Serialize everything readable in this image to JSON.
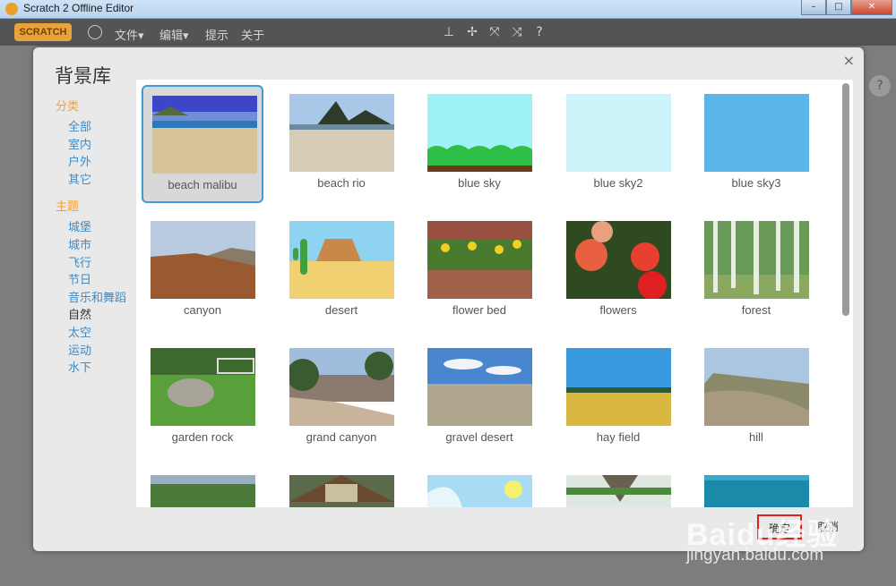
{
  "window": {
    "title": "Scratch 2 Offline Editor"
  },
  "menubar": {
    "logo": "SCRATCH",
    "items": [
      "文件▾",
      "编辑▾",
      "提示",
      "关于"
    ]
  },
  "dialog": {
    "title": "背景库",
    "close": "×",
    "categories": {
      "heading": "分类",
      "items": [
        "全部",
        "室内",
        "户外",
        "其它"
      ]
    },
    "themes": {
      "heading": "主题",
      "items": [
        "城堡",
        "城市",
        "飞行",
        "节日",
        "音乐和舞蹈",
        "自然",
        "太空",
        "运动",
        "水下"
      ],
      "active": "自然"
    },
    "backdrops": [
      {
        "name": "beach malibu",
        "selected": true
      },
      {
        "name": "beach rio"
      },
      {
        "name": "blue sky"
      },
      {
        "name": "blue sky2"
      },
      {
        "name": "blue sky3"
      },
      {
        "name": "canyon"
      },
      {
        "name": "desert"
      },
      {
        "name": "flower bed"
      },
      {
        "name": "flowers"
      },
      {
        "name": "forest"
      },
      {
        "name": "garden rock"
      },
      {
        "name": "grand canyon"
      },
      {
        "name": "gravel desert"
      },
      {
        "name": "hay field"
      },
      {
        "name": "hill"
      },
      {
        "name": ""
      },
      {
        "name": ""
      },
      {
        "name": ""
      },
      {
        "name": ""
      },
      {
        "name": ""
      }
    ],
    "ok_label": "确定",
    "cancel_label": "取消"
  },
  "watermark": {
    "line1": "Baidu经验",
    "line2": "jingyan.baidu.com"
  }
}
